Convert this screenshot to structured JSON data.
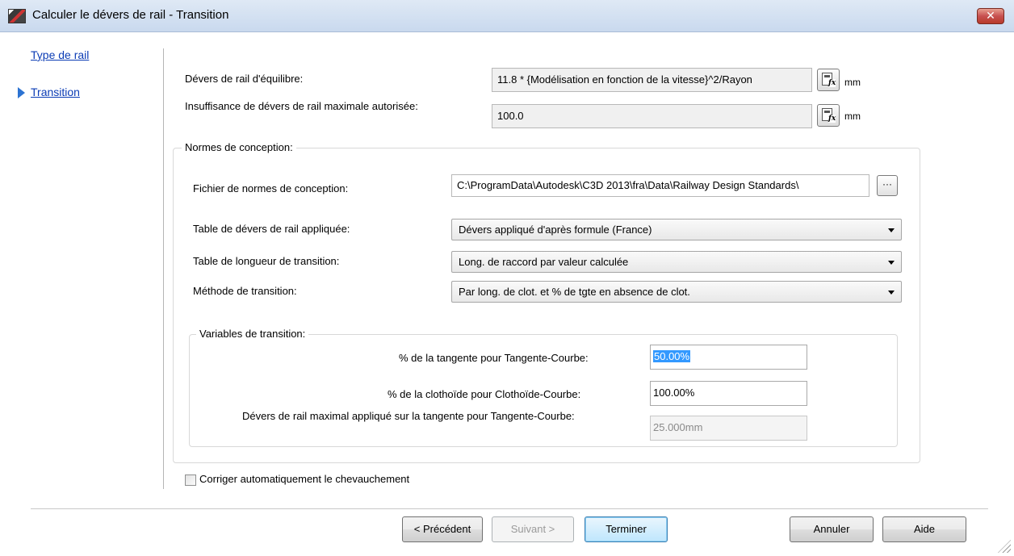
{
  "window": {
    "title": "Calculer le dévers de rail - Transition",
    "close_label": "✕"
  },
  "nav": {
    "items": [
      {
        "label": "Type de rail"
      },
      {
        "label": "Transition"
      }
    ]
  },
  "equilibrium": {
    "label": "Dévers de rail d'équilibre:",
    "value": "11.8 * {Modélisation en fonction de la vitesse}^2/Rayon",
    "unit": "mm"
  },
  "deficiency": {
    "label": "Insuffisance de dévers de rail maximale autorisée:",
    "value": "100.0",
    "unit": "mm"
  },
  "design_standards": {
    "group_title": "Normes de conception:",
    "file_label": "Fichier de normes de conception:",
    "file_value": "C:\\ProgramData\\Autodesk\\C3D 2013\\fra\\Data\\Railway Design Standards\\",
    "browse_label": "···",
    "cant_table_label": "Table de dévers de rail appliquée:",
    "cant_table_value": "Dévers appliqué d'après formule (France)",
    "length_table_label": "Table de longueur de transition:",
    "length_table_value": "Long. de raccord par valeur calculée",
    "method_label": "Méthode de transition:",
    "method_value": "Par long. de clot. et % de tgte en absence de clot."
  },
  "variables": {
    "group_title": "Variables de transition:",
    "tangent_label": "% de la tangente pour Tangente-Courbe:",
    "tangent_value": "50.00%",
    "clothoid_label": "% de la clothoïde pour Clothoïde-Courbe:",
    "clothoid_value": "100.00%",
    "max_cant_label": "Dévers de rail maximal appliqué sur la tangente pour Tangente-Courbe:",
    "max_cant_value": "25.000mm"
  },
  "overlap": {
    "label": "Corriger automatiquement le chevauchement",
    "checked": false
  },
  "buttons": {
    "previous": "< Précédent",
    "next": "Suivant >",
    "finish": "Terminer",
    "cancel": "Annuler",
    "help": "Aide"
  }
}
